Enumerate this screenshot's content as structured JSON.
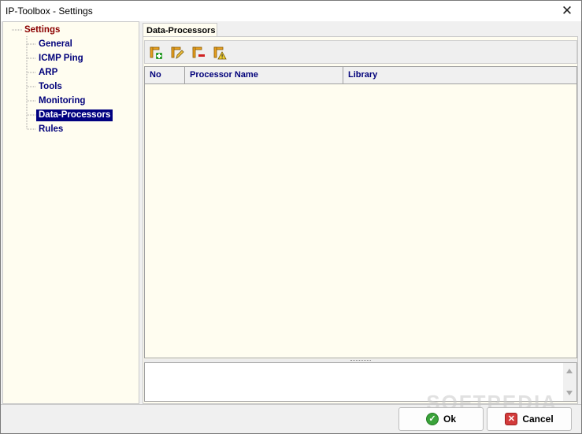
{
  "window": {
    "title": "IP-Toolbox - Settings",
    "close_glyph": "✕"
  },
  "tree": {
    "root": "Settings",
    "items": [
      {
        "label": "General"
      },
      {
        "label": "ICMP Ping"
      },
      {
        "label": "ARP"
      },
      {
        "label": "Tools"
      },
      {
        "label": "Monitoring"
      },
      {
        "label": "Data-Processors",
        "selected": true
      },
      {
        "label": "Rules"
      }
    ]
  },
  "tab": {
    "label": "Data-Processors"
  },
  "toolbar": {
    "buttons": [
      {
        "name": "add-processor",
        "icon": "add-icon"
      },
      {
        "name": "edit-processor",
        "icon": "edit-icon"
      },
      {
        "name": "remove-processor",
        "icon": "remove-icon"
      },
      {
        "name": "warning-processor",
        "icon": "warning-icon"
      }
    ]
  },
  "grid": {
    "columns": [
      "No",
      "Processor Name",
      "Library"
    ],
    "rows": []
  },
  "buttons": {
    "ok": "Ok",
    "cancel": "Cancel"
  },
  "watermark": "SOFTPEDIA",
  "colors": {
    "panel_bg": "#fffdf0",
    "tree_root": "#8b0000",
    "tree_item": "#00007a",
    "selected_bg": "#000080"
  }
}
